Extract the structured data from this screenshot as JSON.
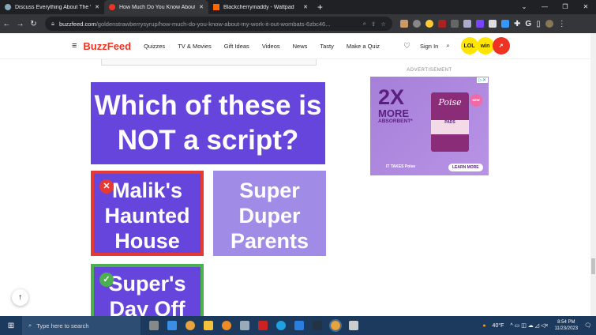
{
  "browser": {
    "tabs": [
      {
        "title": "Discuss Everything About The W",
        "active": false
      },
      {
        "title": "How Much Do You Know About",
        "active": true
      },
      {
        "title": "Blackcherrymaddy - Wattpad",
        "active": false
      }
    ],
    "url_host": "buzzfeed.com",
    "url_path": "/goldenstrawberrysyrup/how-much-do-you-know-about-my-work-it-out-wombats-6zbc46..."
  },
  "site": {
    "logo": "BuzzFeed",
    "nav": [
      "Quizzes",
      "TV & Movies",
      "Gift Ideas",
      "Videos",
      "News",
      "Tasty",
      "Make a Quiz"
    ],
    "sign_in": "Sign In",
    "badges": [
      "LOL",
      "win",
      ""
    ]
  },
  "quiz": {
    "question": "Which of these is NOT a script?",
    "answers": [
      {
        "text": "Malik's Haunted House",
        "state": "wrong"
      },
      {
        "text": "Super Duper Parents",
        "state": "none"
      },
      {
        "text": "Super's Day Off",
        "state": "correct"
      }
    ]
  },
  "ad": {
    "label": "ADVERTISEMENT",
    "headline": "2X",
    "line2": "MORE",
    "line3": "ABSORBENT*",
    "brand": "Poise",
    "product": "PADS",
    "new": "NEW",
    "cta": "LEARN MORE",
    "tagline": "IT TAKES Poise"
  },
  "taskbar": {
    "search_placeholder": "Type here to search",
    "weather": "40°F",
    "time": "8:54 PM",
    "date": "11/23/2023"
  },
  "colors": {
    "accent": "#e32",
    "purple": "#6645dd",
    "wrong": "#e53935",
    "correct": "#4caf50"
  }
}
